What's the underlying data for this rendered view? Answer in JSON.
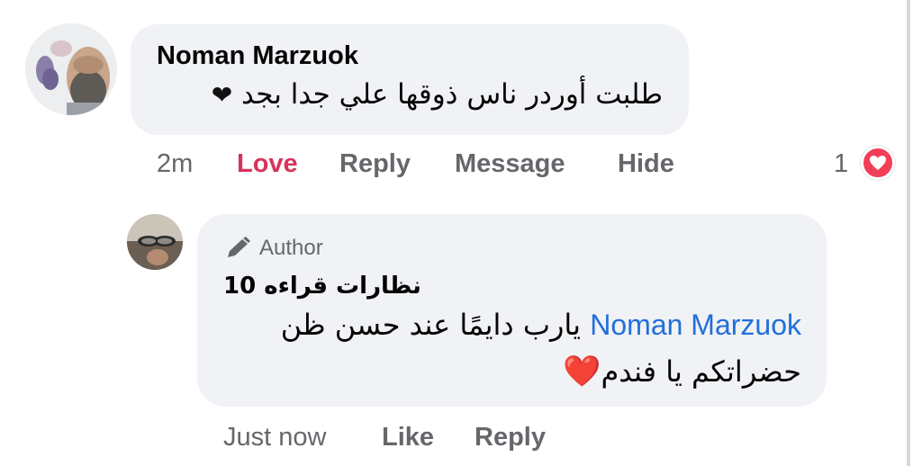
{
  "comment": {
    "author": "Noman Marzuok",
    "text": "طلبت أوردر ناس ذوقها علي جدا بجد",
    "text_emoji": "❤",
    "actions": {
      "time": "2m",
      "love": "Love",
      "reply": "Reply",
      "message": "Message",
      "hide": "Hide"
    },
    "reaction_count": "1",
    "reaction_icon": "love-reaction-icon",
    "love_color": "#d6335b"
  },
  "reply": {
    "badge_label": "Author",
    "badge_icon": "pencil-icon",
    "author": "نظارات قراءه 10",
    "mention": "Noman Marzuok",
    "line1_rest": "يارب دايمًا عند حسن ظن",
    "line2": "حضراتكم يا فندم",
    "line2_emoji": "❤️",
    "mention_color": "#216fdb",
    "actions": {
      "time": "Just now",
      "like": "Like",
      "reply": "Reply"
    }
  }
}
